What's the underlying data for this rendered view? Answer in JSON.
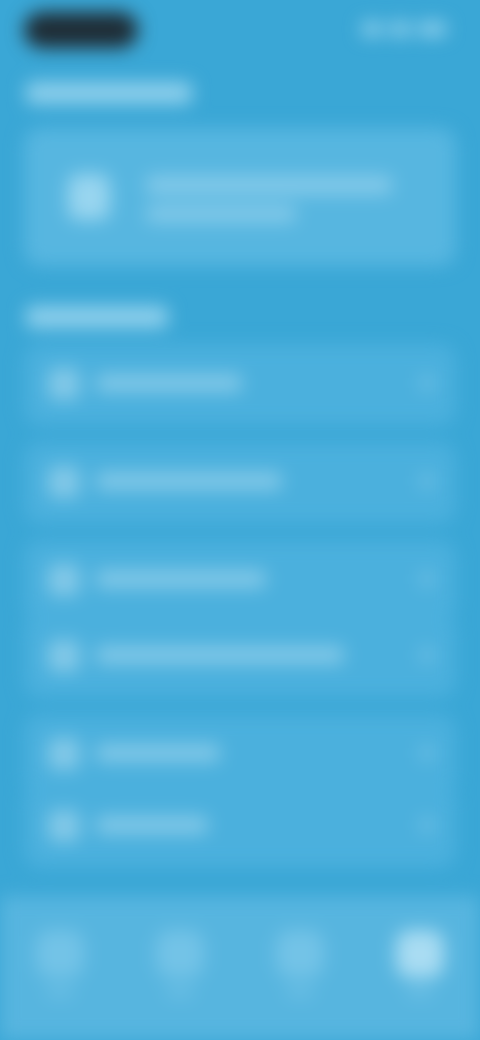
{
  "theme": {
    "background": "#3aa7d6",
    "card": "#4bb0dd",
    "promo_card": "#57b6e0",
    "bottom_nav": "#57b5df",
    "status_pill": "#1f2d36"
  },
  "icons": {
    "status": [
      "signal-icon",
      "wifi-icon",
      "battery-icon"
    ],
    "bottom_nav": [
      "home-icon",
      "search-icon",
      "grid-icon",
      "profile-icon"
    ]
  }
}
